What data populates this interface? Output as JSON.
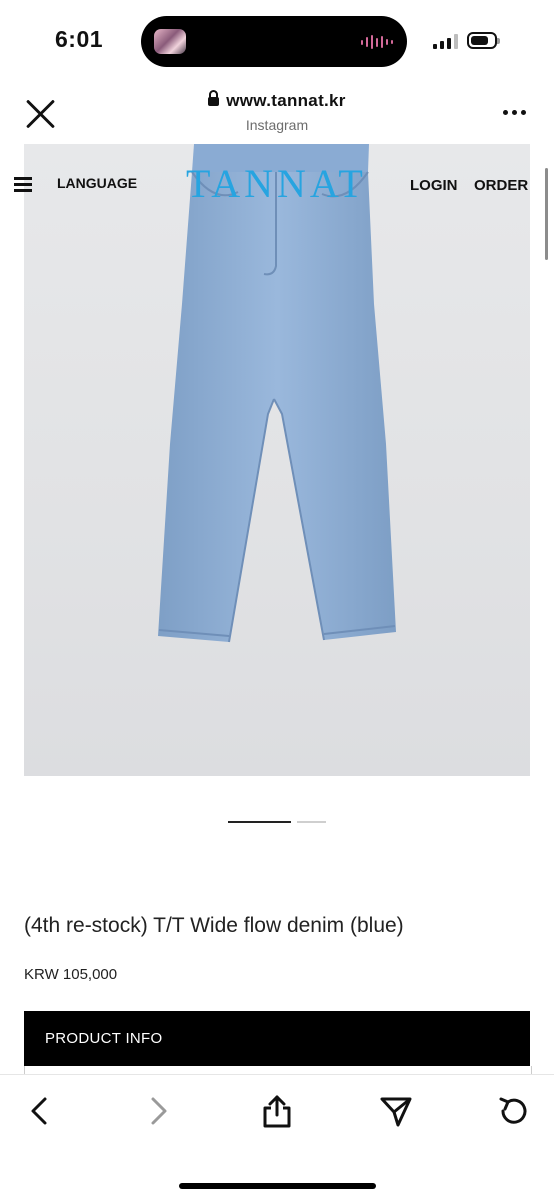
{
  "status_bar": {
    "time": "6:01"
  },
  "browser": {
    "url": "www.tannat.kr",
    "source": "Instagram"
  },
  "site_nav": {
    "language_label": "LANGUAGE",
    "logo": "TANNAT",
    "login_label": "LOGIN",
    "order_label": "ORDER"
  },
  "carousel": {
    "current_slide": 1,
    "total_slides": 2
  },
  "product": {
    "title": "(4th re-stock) T/T Wide flow denim (blue)",
    "price": "KRW 105,000",
    "info_label": "PRODUCT INFO"
  },
  "colors": {
    "logo": "#27a4e0",
    "denim": "#8fb0d6",
    "info_bar": "#000000"
  },
  "icons": {
    "close": "close-icon",
    "lock": "lock-icon",
    "more": "more-icon",
    "menu": "hamburger-menu-icon",
    "back": "chevron-left-icon",
    "forward": "chevron-right-icon",
    "share": "share-icon",
    "send": "send-icon",
    "reload": "reload-icon"
  }
}
